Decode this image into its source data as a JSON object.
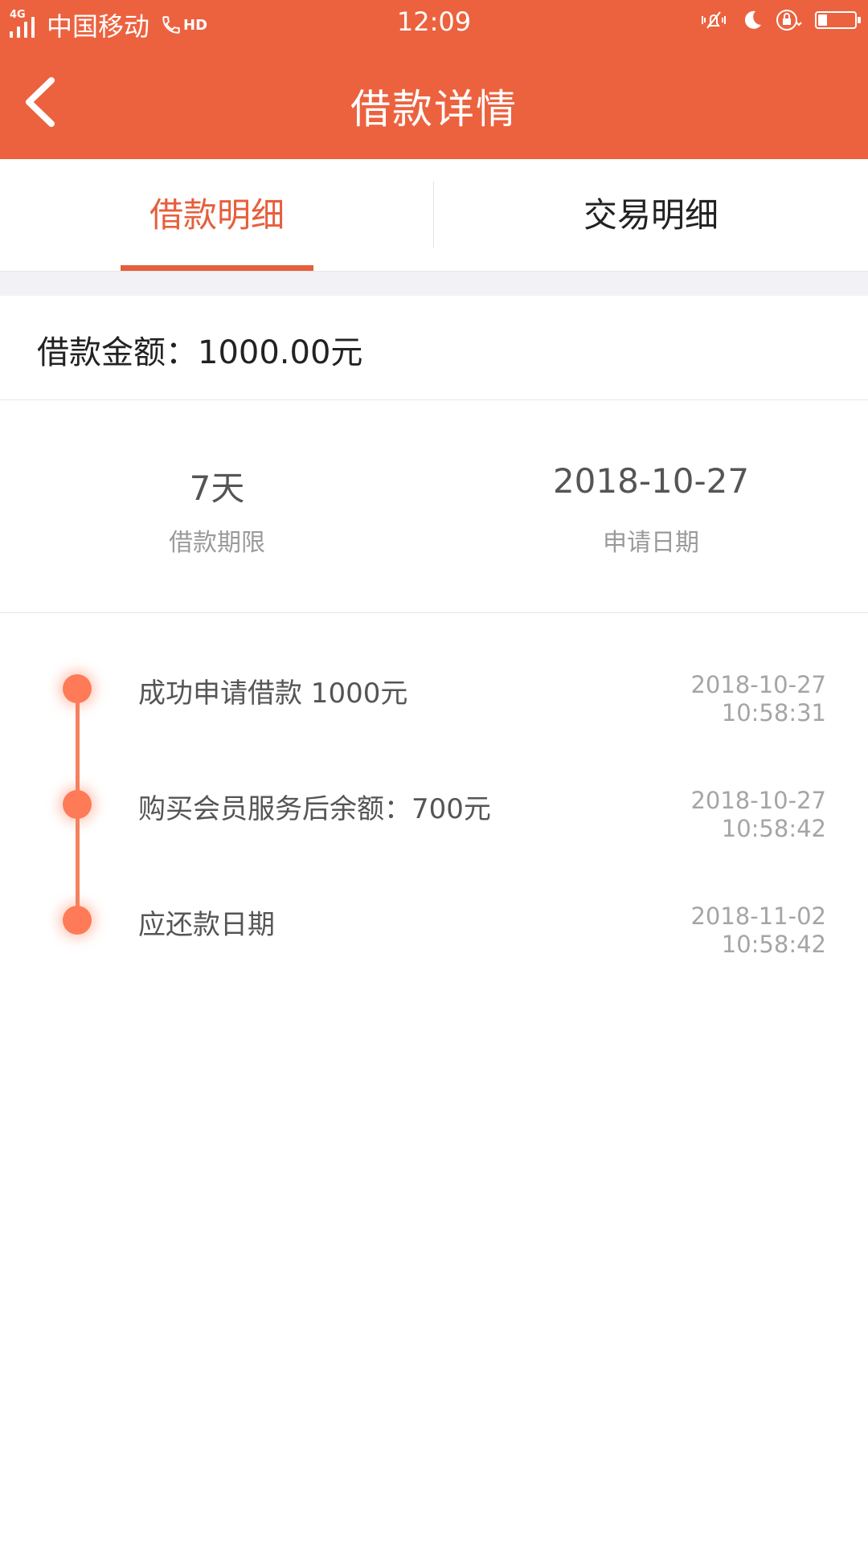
{
  "status_bar": {
    "network": "4G",
    "carrier": "中国移动",
    "hd": "HD",
    "time": "12:09",
    "battery_level": 0.25
  },
  "app_bar": {
    "title": "借款详情"
  },
  "tabs": [
    {
      "label": "借款明细",
      "active": true
    },
    {
      "label": "交易明细",
      "active": false
    }
  ],
  "loan": {
    "amount_text": "借款金额：1000.00元"
  },
  "stats": [
    {
      "value": "7天",
      "caption": "借款期限"
    },
    {
      "value": "2018-10-27",
      "caption": "申请日期"
    }
  ],
  "timeline": [
    {
      "text": "成功申请借款 1000元",
      "date": "2018-10-27",
      "time": "10:58:31"
    },
    {
      "text": "购买会员服务后余额：700元",
      "date": "2018-10-27",
      "time": "10:58:42"
    },
    {
      "text": "应还款日期",
      "date": "2018-11-02",
      "time": "10:58:42"
    }
  ],
  "colors": {
    "header_bg": "#EC623F",
    "accent": "#E65F3C",
    "timeline_dot": "#FF7A57",
    "section_gap": "#F2F2F6"
  }
}
